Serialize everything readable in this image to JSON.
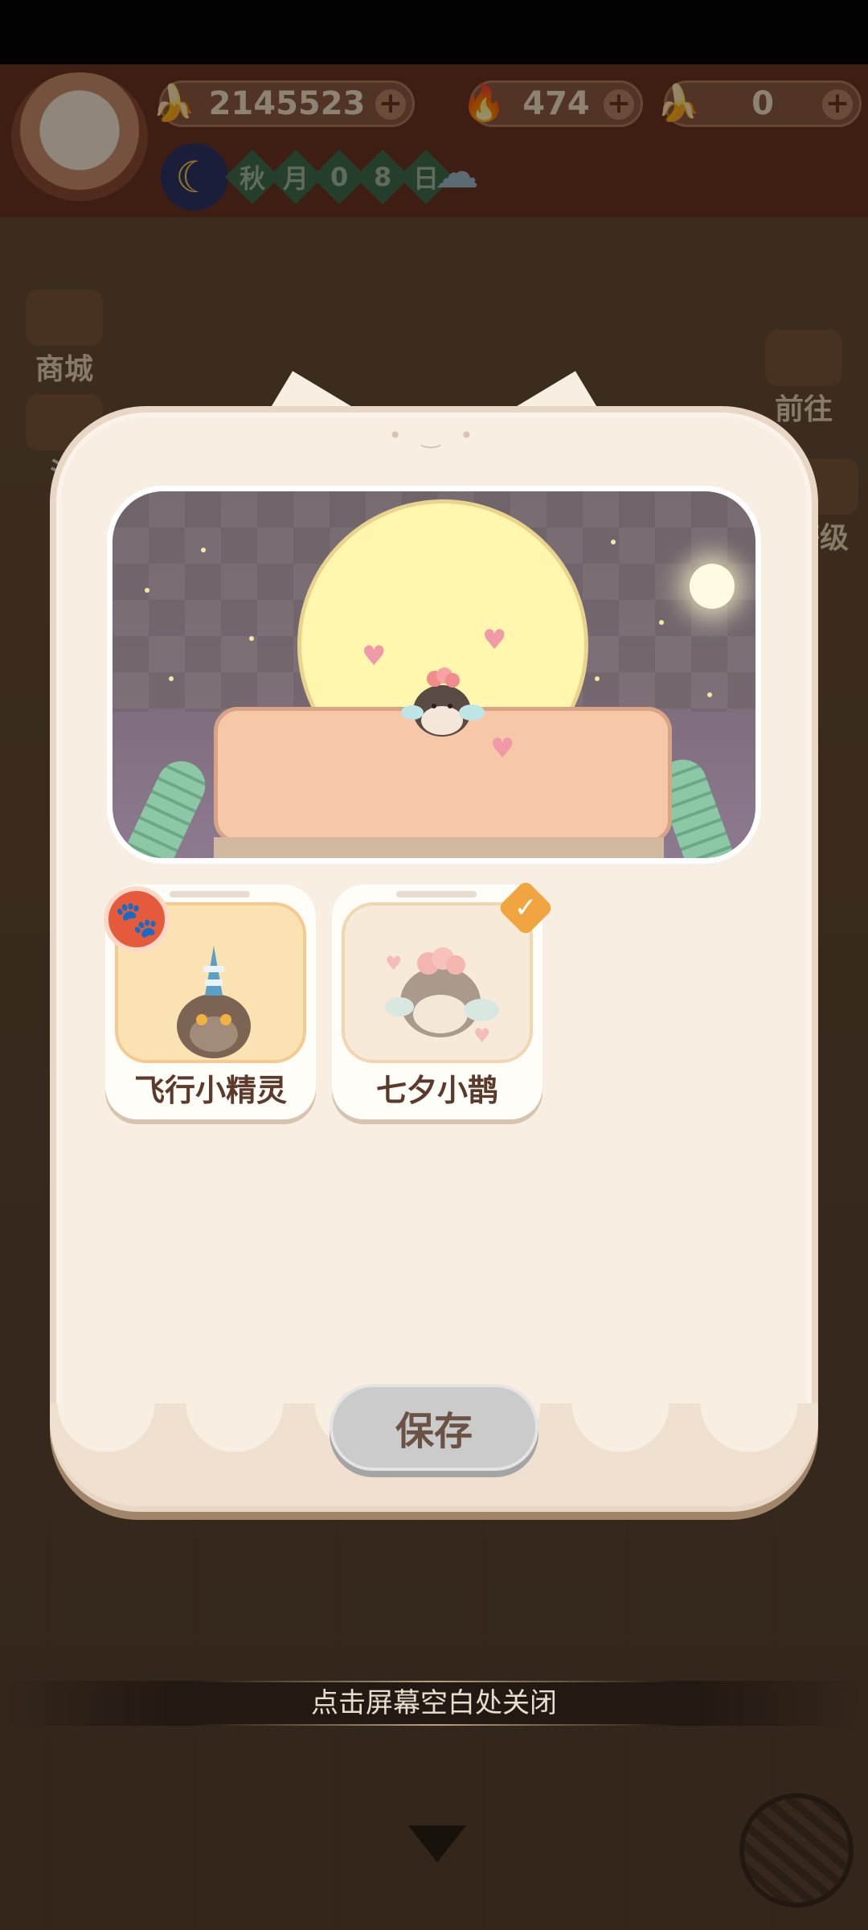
{
  "resources": {
    "bananas": "2145523",
    "fire": "474",
    "blue_banana": "0"
  },
  "season": {
    "chars": [
      "秋",
      "月",
      "0",
      "8",
      "日"
    ]
  },
  "side_buttons": {
    "shop": "商城",
    "activity": "活",
    "goto": "前往",
    "level": "等级"
  },
  "skins": [
    {
      "name": "飞行小精灵",
      "selected": false,
      "badge": "paw"
    },
    {
      "name": "七夕小鹊",
      "selected": true,
      "badge": "check"
    }
  ],
  "save_label": "保存",
  "close_hint": "点击屏幕空白处关闭",
  "colors": {
    "accent": "#f0a541",
    "badge_red": "#e65a3c",
    "panel": "#f8eee2",
    "save_button": "#cbcbcb"
  }
}
